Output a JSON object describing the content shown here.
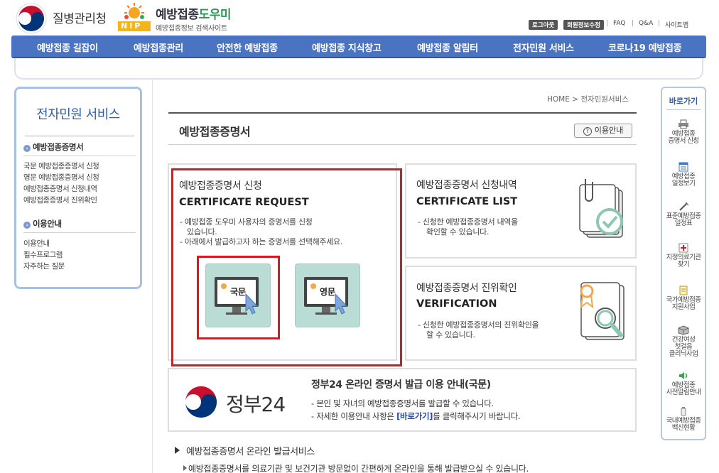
{
  "header": {
    "agency_name": "질병관리청",
    "nip_badge": "NIP",
    "site_title_a": "예방접종",
    "site_title_b": "도우미",
    "site_subtitle": "예방접종정보 검색사이트",
    "util": {
      "logout": "로그아웃",
      "edit_profile": "회원정보수정",
      "faq": "FAQ",
      "qna": "Q&A",
      "sitemap": "사이트맵",
      "sep": "|"
    }
  },
  "nav": {
    "items": [
      "예방접종 길잡이",
      "예방접종관리",
      "안전한 예방접종",
      "예방접종 지식창고",
      "예방접종 알림터",
      "전자민원 서비스",
      "코로나19 예방접종"
    ]
  },
  "sidebar": {
    "title": "전자민원 서비스",
    "sec1": "예방접종증명서",
    "sec1_items": [
      "국문 예방접종증명서 신청",
      "영문 예방접종증명서 신청",
      "예방접종증명서 신청내역",
      "예방접종증명서 진위확인"
    ],
    "sec2": "이용안내",
    "sec2_items": [
      "이용안내",
      "필수프로그램",
      "자주하는 질문"
    ]
  },
  "breadcrumb": "HOME > 전자민원서비스",
  "page_title": "예방접종증명서",
  "guide_button": "이용안내",
  "cards": {
    "request": {
      "title": "예방접종증명서 신청",
      "en": "CERTIFICATE REQUEST",
      "desc1": "- 예방접종 도우미 사용자의 증명서를 신청",
      "desc1b": "있습니다.",
      "desc2": "- 아래에서 발급하고자 하는 증명서를 선택해주세요.",
      "btn_korean": "국문",
      "btn_english": "영문"
    },
    "list": {
      "title": "예방접종증명서 신청내역",
      "en": "CERTIFICATE LIST",
      "desc1": "- 신청한 예방접종증명서 내역을",
      "desc1b": "확인할 수 있습니다."
    },
    "verify": {
      "title": "예방접종증명서 진위확인",
      "en": "VERIFICATION",
      "desc1": "- 신청한 예방접종증명서의 진위확인을",
      "desc1b": "할 수 있습니다."
    }
  },
  "gov24": {
    "logo_text": "정부24",
    "title": "정부24 온라인 증명서 발급 이용 안내(국문)",
    "desc1": "- 본인 및 자녀의 예방접종증명서를 발급할 수 있습니다.",
    "desc2_a": "- 자세한 이용안내 사항은 ",
    "desc2_link": "[바로가기]",
    "desc2_b": "를 클릭해주시기 바랍니다."
  },
  "bottom": {
    "heading": "예방접종증명서 온라인 발급서비스",
    "para": "예방접종증명서를 의료기관 및 보건기관 방문없이 간편하게 온라인을 통해 발급받으실 수 있습니다."
  },
  "quick": {
    "title": "바로가기",
    "items": [
      {
        "l1": "예방접종",
        "l2": "증명서 신청",
        "icon": "printer-icon"
      },
      {
        "l1": "예방접종",
        "l2": "일정보기",
        "icon": "calendar-icon"
      },
      {
        "l1": "표준예방접종",
        "l2": "일정표",
        "icon": "syringe-icon"
      },
      {
        "l1": "지정의료기관",
        "l2": "찾기",
        "icon": "hospital-icon"
      },
      {
        "l1": "국가예방접종",
        "l2": "지원사업",
        "icon": "document-icon"
      },
      {
        "l1": "건강여성",
        "l2": "첫걸음",
        "l3": "클리닉사업",
        "icon": "box-icon"
      },
      {
        "l1": "예방접종",
        "l2": "사전알림안내",
        "icon": "speaker-icon"
      },
      {
        "l1": "국내예방접종",
        "l2": "백신현황",
        "icon": "vial-icon"
      }
    ]
  },
  "colors": {
    "nav": "#4a73c2",
    "highlight": "#e0161e",
    "card_button": "#b9dcd4",
    "accent": "#2f5ea8"
  }
}
